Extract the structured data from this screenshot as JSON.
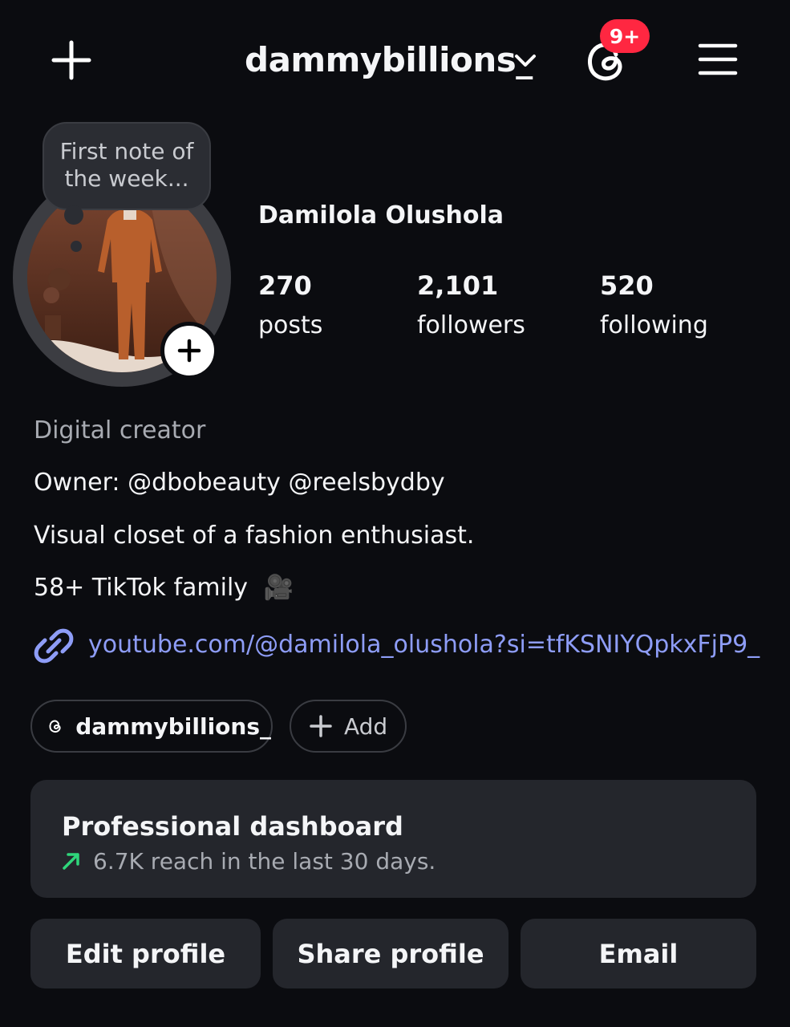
{
  "header": {
    "username": "dammybillions_",
    "notification_badge": "9+",
    "badge_color": "#ff2741",
    "icons": [
      "plus-icon",
      "chevron-down-icon",
      "threads-icon",
      "menu-icon"
    ]
  },
  "note": {
    "text": "First note of the week..."
  },
  "profile": {
    "full_name": "Damilola Olushola",
    "stats": [
      {
        "value": "270",
        "label": "posts"
      },
      {
        "value": "2,101",
        "label": "followers"
      },
      {
        "value": "520",
        "label": "following"
      }
    ]
  },
  "bio": {
    "category": "Digital creator",
    "line1": "Owner: @dbobeauty @reelsbydby",
    "line2": "Visual closet of a fashion enthusiast.",
    "line3": "58+ TikTok family",
    "line3_emoji": "🎥",
    "link": "youtube.com/@damilola_olushola?si=tfKSNIYQpkxFjP9_",
    "link_color": "#8e9df7"
  },
  "pills": {
    "threads_handle": "dammybillions_",
    "add_label": "Add"
  },
  "dashboard": {
    "title": "Professional dashboard",
    "subtitle": "6.7K reach in the last 30 days.",
    "trend_color": "#2fd67b"
  },
  "actions": {
    "edit": "Edit profile",
    "share": "Share profile",
    "email": "Email"
  }
}
